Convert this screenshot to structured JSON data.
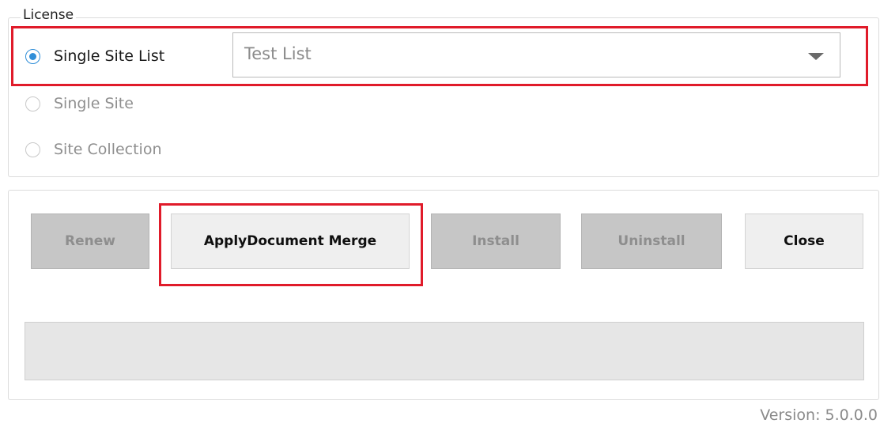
{
  "license": {
    "legend": "License",
    "options": [
      {
        "label": "Single Site List",
        "checked": true,
        "enabled": true
      },
      {
        "label": "Single Site",
        "checked": false,
        "enabled": false
      },
      {
        "label": "Site Collection",
        "checked": false,
        "enabled": false
      }
    ],
    "list_select": {
      "value": "Test List"
    }
  },
  "actions": {
    "renew_label": "Renew",
    "apply_label": "ApplyDocument Merge",
    "install_label": "Install",
    "uninstall_label": "Uninstall",
    "close_label": "Close"
  },
  "progress": {
    "value": 0
  },
  "version_text": "Version: 5.0.0.0",
  "colors": {
    "highlight": "#e01b2a",
    "radio_accent": "#2f8ed8",
    "disabled_button": "#c6c6c6",
    "enabled_button": "#efefef"
  }
}
